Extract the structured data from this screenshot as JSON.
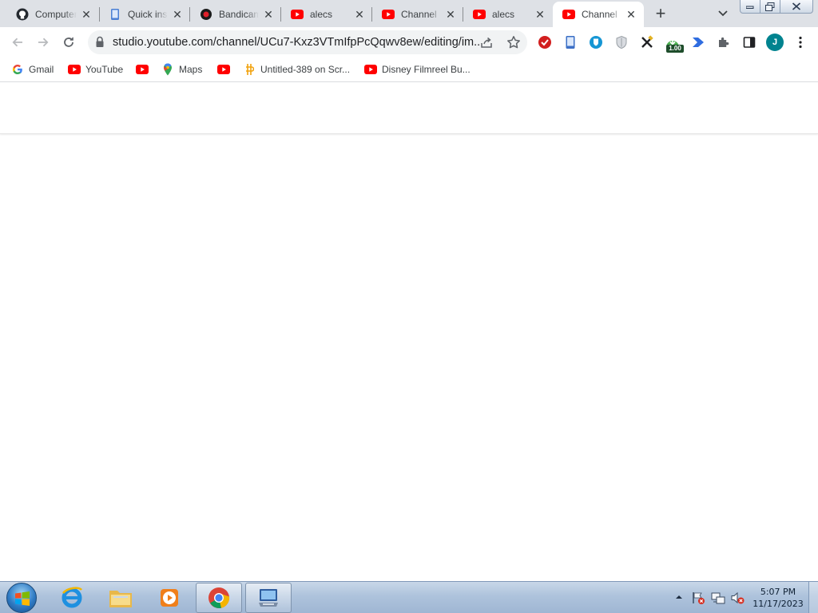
{
  "browser": {
    "tabs": [
      {
        "title": "Computer",
        "icon": "github-icon",
        "active": false
      },
      {
        "title": "Quick insights",
        "icon": "phone-icon",
        "active": false
      },
      {
        "title": "Bandicam",
        "icon": "record-icon",
        "active": false
      },
      {
        "title": "alecs",
        "icon": "youtube-icon",
        "active": false
      },
      {
        "title": "Channel",
        "icon": "youtube-icon",
        "active": false
      },
      {
        "title": "alecs",
        "icon": "youtube-icon",
        "active": false
      },
      {
        "title": "Channel",
        "icon": "youtube-icon",
        "active": true
      }
    ],
    "tab_close_glyph": "✕",
    "new_tab_glyph": "+",
    "url": "studio.youtube.com/channel/UCu7-Kxz3VTmIfpPcQqwv8ew/editing/im...",
    "profile_initial": "J",
    "extension_badge": "1.00",
    "extensions": [
      "adblock-icon",
      "phone-icon",
      "bitwarden-icon",
      "shield-icon",
      "tools-icon",
      "download-icon",
      "arrow-extension-icon",
      "puzzle-icon",
      "sidepanel-icon"
    ]
  },
  "bookmarks": [
    {
      "label": "Gmail",
      "icon": "google-icon"
    },
    {
      "label": "YouTube",
      "icon": "youtube-icon"
    },
    {
      "label": "",
      "icon": "youtube-icon"
    },
    {
      "label": "Maps",
      "icon": "maps-icon"
    },
    {
      "label": "",
      "icon": "youtube-icon"
    },
    {
      "label": "Untitled-389 on Scr...",
      "icon": "scratch-icon"
    },
    {
      "label": "Disney Filmreel Bu...",
      "icon": "youtube-icon"
    }
  ],
  "taskbar": {
    "apps": [
      "internet-explorer-icon",
      "file-explorer-icon",
      "media-player-icon",
      "chrome-icon",
      "remote-desktop-icon"
    ],
    "clock_time": "5:07 PM",
    "clock_date": "11/17/2023"
  },
  "colors": {
    "tabstrip": "#dee1e6",
    "youtube_red": "#ff0000",
    "avatar": "#00838f",
    "taskbar": "#aec3dc"
  }
}
